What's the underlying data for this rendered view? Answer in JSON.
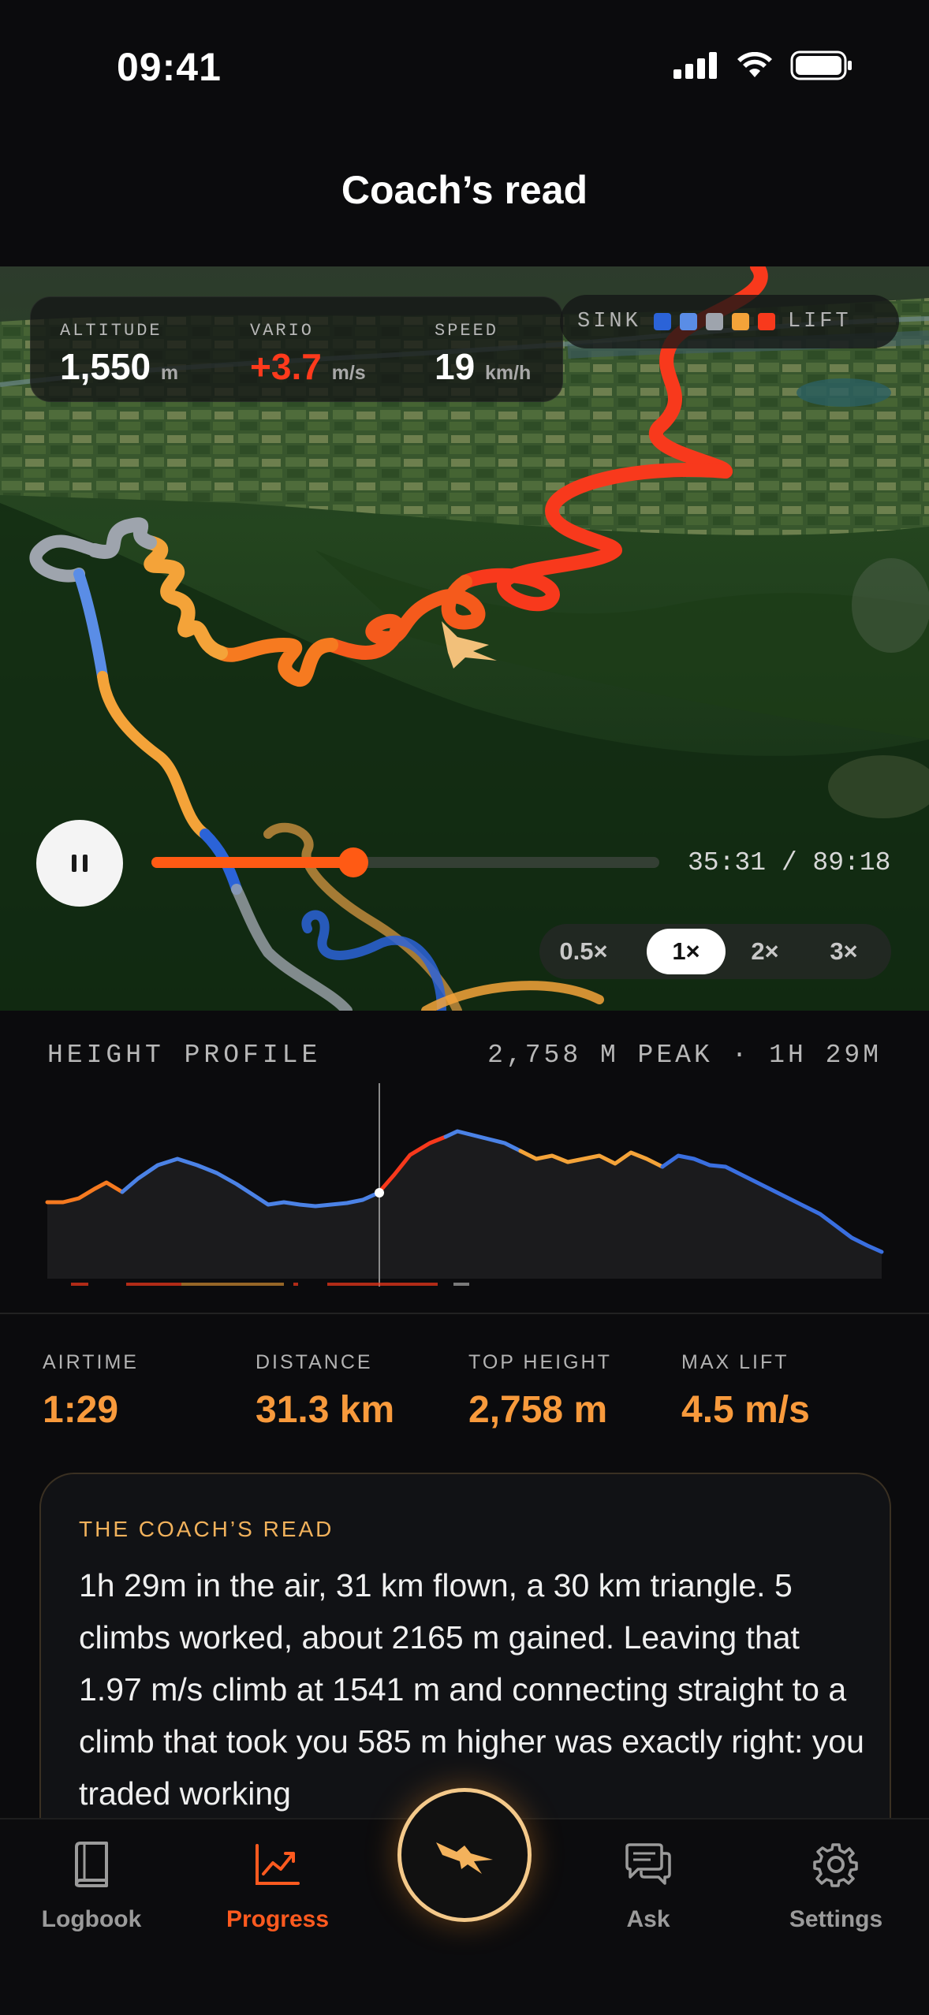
{
  "status": {
    "time": "09:41"
  },
  "header": {
    "title": "Coach’s read"
  },
  "hud": {
    "altitude": {
      "label": "ALTITUDE",
      "value": "1,550",
      "unit": "m"
    },
    "vario": {
      "label": "VARIO",
      "value": "+3.7",
      "unit": "m/s"
    },
    "speed": {
      "label": "SPEED",
      "value": "19",
      "unit": "km/h"
    }
  },
  "legend": {
    "left": "SINK",
    "right": "LIFT",
    "colors": [
      "#2b63d8",
      "#5a8de6",
      "#9ea4ad",
      "#f4a339",
      "#f8391c"
    ]
  },
  "playback": {
    "time": "35:31 / 89:18",
    "progress": 0.398,
    "speeds": [
      "0.5×",
      "1×",
      "2×",
      "3×"
    ],
    "active_speed": "1×"
  },
  "profile": {
    "label": "HEIGHT PROFILE",
    "meta": "2,758 M PEAK · 1H 29M"
  },
  "stats": [
    {
      "label": "AIRTIME",
      "value": "1:29"
    },
    {
      "label": "DISTANCE",
      "value": "31.3 km"
    },
    {
      "label": "TOP HEIGHT",
      "value": "2,758 m"
    },
    {
      "label": "MAX LIFT",
      "value": "4.5 m/s"
    }
  ],
  "coach": {
    "title": "THE COACH’S READ",
    "body": "1h 29m in the air, 31 km flown, a 30 km triangle. 5 climbs worked, about 2165 m gained. Leaving that 1.97 m/s climb at 1541 m and connecting straight to a climb that took you 585 m higher was exactly right: you traded working"
  },
  "tabs": [
    {
      "label": "Logbook",
      "icon": "book-icon"
    },
    {
      "label": "Progress",
      "icon": "chart-icon"
    },
    {
      "label": "Ask",
      "icon": "chat-icon"
    },
    {
      "label": "Settings",
      "icon": "gear-icon"
    }
  ],
  "center_button": {
    "icon": "bird-icon"
  }
}
